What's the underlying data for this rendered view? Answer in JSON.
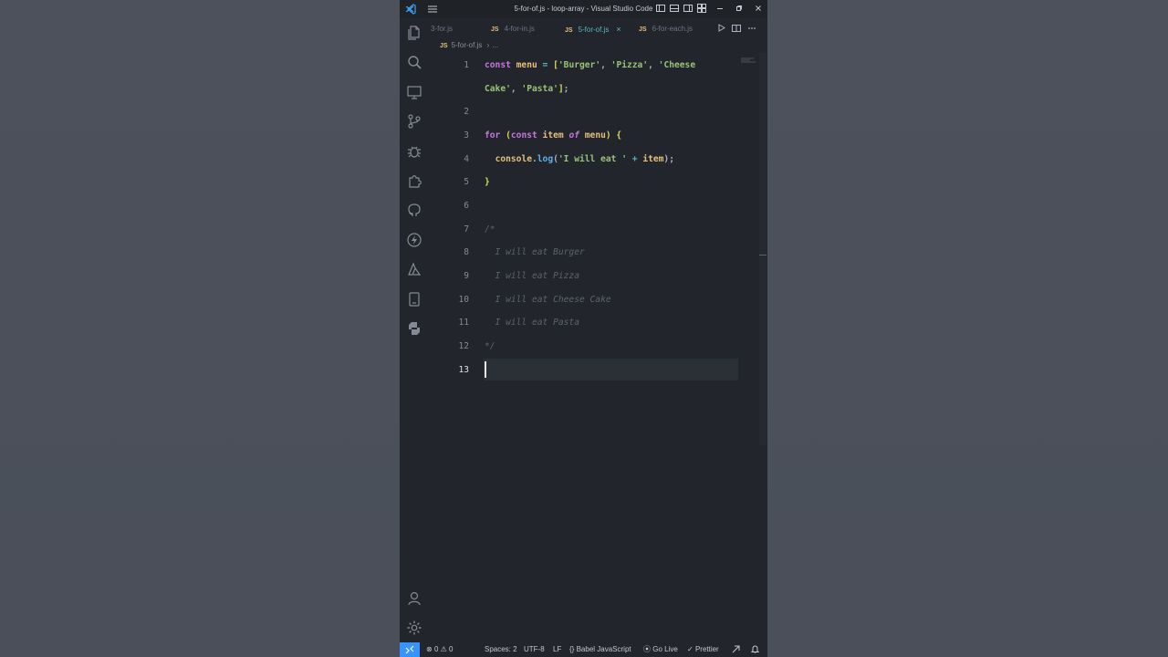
{
  "window": {
    "title": "5-for-of.js - loop-array - Visual Studio Code",
    "menu_icon": "hamburger-menu-icon"
  },
  "tabs": [
    {
      "label": "3-for.js",
      "badge": "",
      "active": false
    },
    {
      "label": "4-for-in.js",
      "badge": "JS",
      "active": false
    },
    {
      "label": "5-for-of.js",
      "badge": "JS",
      "active": true,
      "close": "×"
    },
    {
      "label": "6-for-each.js",
      "badge": "JS",
      "active": false
    }
  ],
  "breadcrumb": {
    "badge": "JS",
    "file": "5-for-of.js",
    "sep": "›",
    "rest": "..."
  },
  "editor": {
    "line_numbers": [
      "1",
      "2",
      "3",
      "4",
      "5",
      "6",
      "7",
      "8",
      "9",
      "10",
      "11",
      "12",
      "13"
    ],
    "current_line": "13"
  },
  "status_bar": {
    "errors": "0",
    "warnings": "0",
    "spaces": "Spaces: 2",
    "encoding": "UTF-8",
    "eol": "LF",
    "language": "Babel JavaScript",
    "go_live": "Go Live",
    "prettier": "Prettier"
  },
  "colors": {
    "accent": "#3794ff",
    "editor_bg": "#22252b",
    "background": "#4b505a"
  }
}
